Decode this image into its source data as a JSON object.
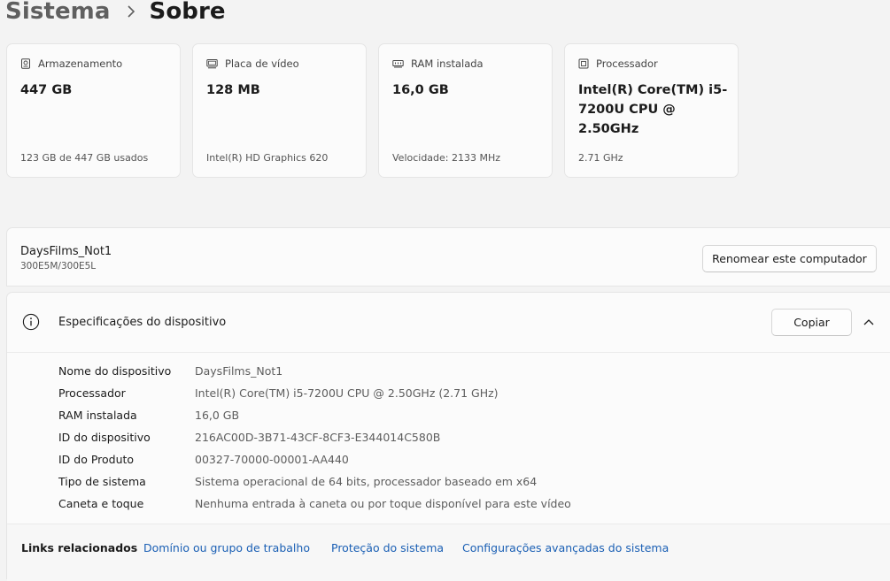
{
  "breadcrumb": {
    "parent": "Sistema",
    "current": "Sobre"
  },
  "cards": [
    {
      "icon": "storage-icon",
      "label": "Armazenamento",
      "value": "447 GB",
      "sub": "123 GB de 447 GB usados"
    },
    {
      "icon": "display-adapter-icon",
      "label": "Placa de vídeo",
      "value": "128 MB",
      "sub": "Intel(R) HD Graphics 620"
    },
    {
      "icon": "ram-icon",
      "label": "RAM instalada",
      "value": "16,0 GB",
      "sub": "Velocidade: 2133 MHz"
    },
    {
      "icon": "processor-icon",
      "label": "Processador",
      "value": "Intel(R) Core(TM) i5-7200U CPU @ 2.50GHz",
      "sub": "2.71 GHz"
    }
  ],
  "device": {
    "name": "DaysFilms_Not1",
    "model": "300E5M/300E5L",
    "rename_label": "Renomear este computador"
  },
  "specs": {
    "title": "Especificações do dispositivo",
    "copy_label": "Copiar",
    "rows": [
      {
        "label": "Nome do dispositivo",
        "value": "DaysFilms_Not1"
      },
      {
        "label": "Processador",
        "value": "Intel(R) Core(TM) i5-7200U CPU @ 2.50GHz (2.71 GHz)"
      },
      {
        "label": "RAM instalada",
        "value": "16,0 GB"
      },
      {
        "label": "ID do dispositivo",
        "value": "216AC00D-3B71-43CF-8CF3-E344014C580B"
      },
      {
        "label": "ID do Produto",
        "value": "00327-70000-00001-AA440"
      },
      {
        "label": "Tipo de sistema",
        "value": "Sistema operacional de 64 bits, processador baseado em x64"
      },
      {
        "label": "Caneta e toque",
        "value": "Nenhuma entrada à caneta ou por toque disponível para este vídeo"
      }
    ]
  },
  "related": {
    "label": "Links relacionados",
    "links": [
      "Domínio ou grupo de trabalho",
      "Proteção do sistema",
      "Configurações avançadas do sistema"
    ]
  },
  "colors": {
    "link": "#1a5fb4",
    "background": "#f3f3f3",
    "card": "#fbfbfb"
  }
}
